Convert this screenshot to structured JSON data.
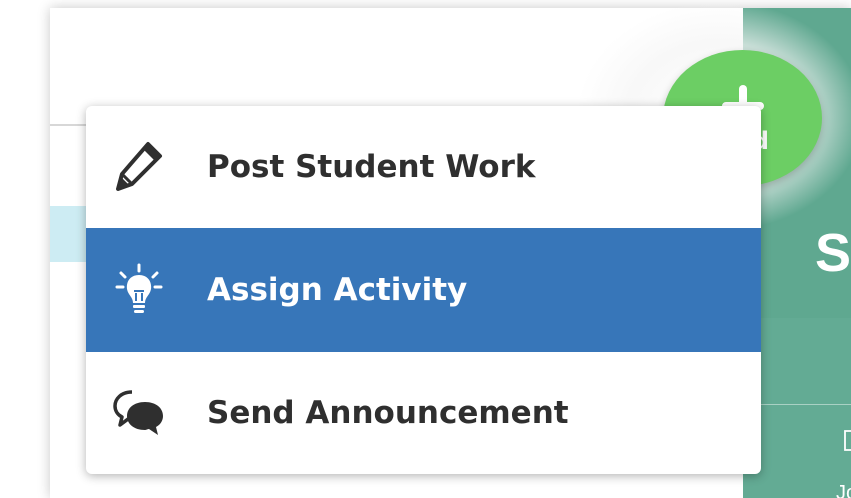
{
  "background": {
    "side_heading_fragment": "ST",
    "side_label_fragment": "Jourr",
    "teal_color": "#5fa890",
    "highlight_strip_color": "#cdecf3"
  },
  "fab": {
    "label": "Add",
    "icon": "plus-icon",
    "color": "#6cce64"
  },
  "menu": {
    "items": [
      {
        "label": "Post Student Work",
        "icon": "pencil-icon",
        "selected": false
      },
      {
        "label": "Assign Activity",
        "icon": "lightbulb-icon",
        "selected": true
      },
      {
        "label": "Send Announcement",
        "icon": "chat-bubbles-icon",
        "selected": false
      }
    ],
    "selected_color": "#3776b9"
  }
}
